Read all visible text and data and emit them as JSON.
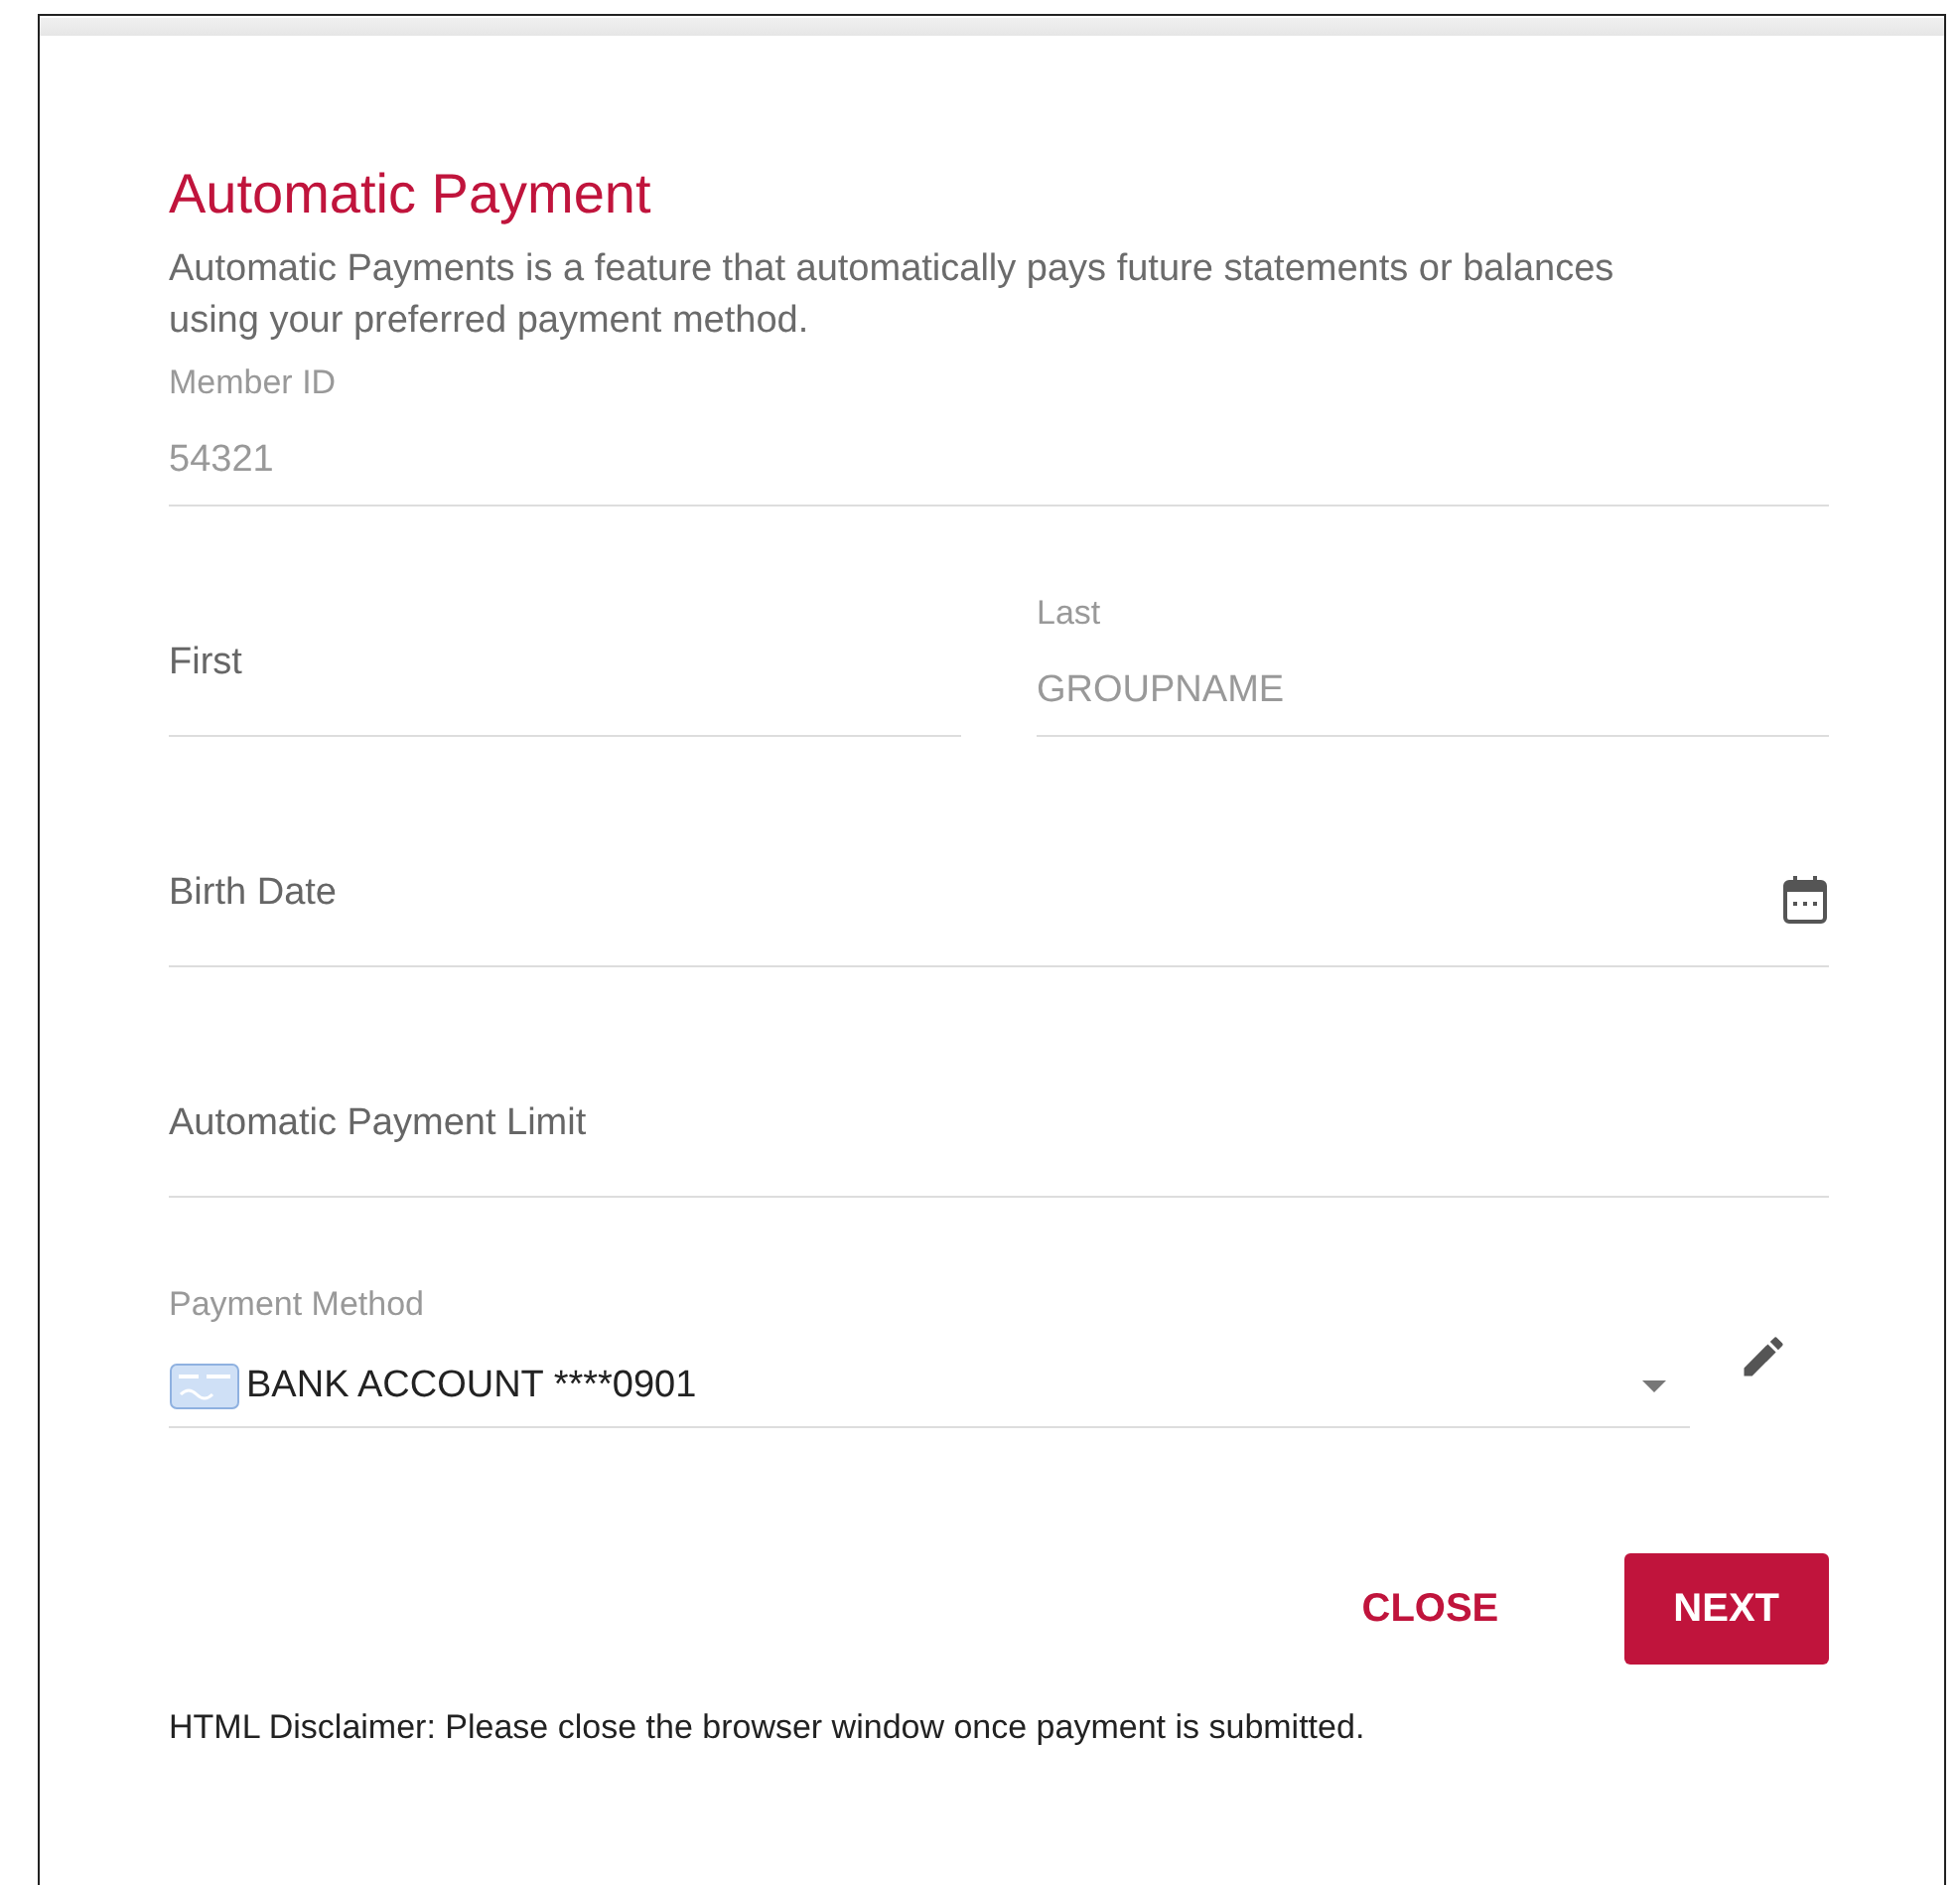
{
  "title": "Automatic Payment",
  "description": "Automatic Payments is a feature that automatically pays future statements or balances using your preferred payment method.",
  "rows": [
    [
      {
        "kind": "text",
        "label": "Member ID",
        "value": "54321",
        "disabled": true
      }
    ],
    [
      {
        "kind": "text",
        "label": "First",
        "disabled": false
      },
      {
        "kind": "text",
        "label": "Last",
        "value": "GROUPNAME",
        "disabled": true
      }
    ],
    [
      {
        "kind": "date",
        "label": "Birth Date",
        "disabled": false
      }
    ],
    [
      {
        "kind": "text",
        "label": "Automatic Payment Limit",
        "disabled": false
      }
    ],
    [
      {
        "kind": "select",
        "label": "Payment Method",
        "value": "BANK ACCOUNT ****0901",
        "disabled": false
      }
    ]
  ],
  "buttons": [
    {
      "kind": "text",
      "label": "CLOSE"
    },
    {
      "kind": "primary",
      "label": "NEXT"
    }
  ],
  "disclaimer": "HTML Disclaimer: Please close the browser window once payment is submitted."
}
